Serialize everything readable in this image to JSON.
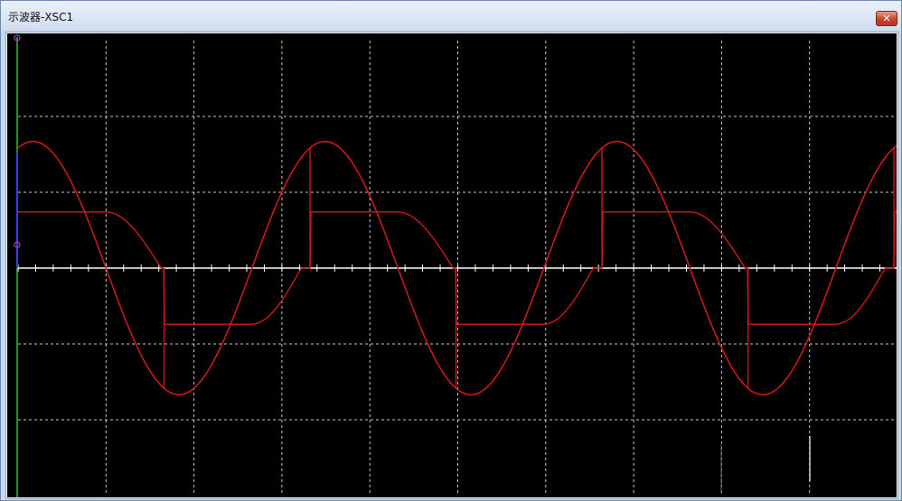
{
  "window": {
    "title": "示波器-XSC1",
    "close_label": "✕"
  },
  "colors": {
    "screen_background": "#000000",
    "grid": "#c8c8c8",
    "axis": "#ffffff",
    "trace": "#cc1a1a",
    "cursor_1": "#3a3aff",
    "cursor_2": "#30c030",
    "marker": "#b040d0"
  },
  "chart_data": {
    "type": "line",
    "grid": true,
    "divisions": {
      "x": 10,
      "y": 6
    },
    "x_range_divisions": [
      0,
      10
    ],
    "y_range_divisions": [
      -3,
      3
    ],
    "cycle_divisions": 3.32,
    "series": [
      {
        "kind": "sine",
        "amplitude_div": 1.67,
        "phase_div": 0.0
      },
      {
        "kind": "clipped",
        "amplitude_div": 0.74,
        "phase_div": 0.0
      }
    ]
  }
}
